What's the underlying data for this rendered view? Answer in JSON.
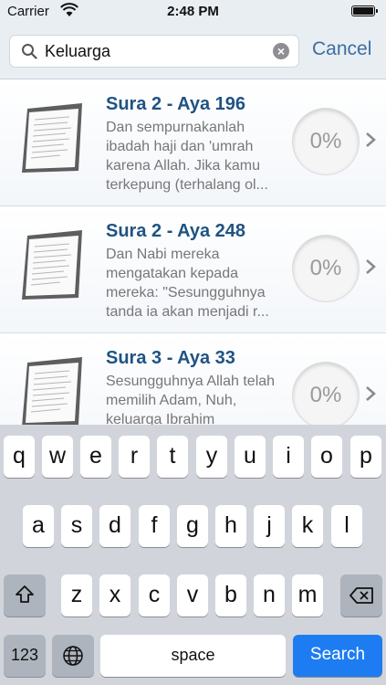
{
  "status": {
    "carrier": "Carrier",
    "time": "2:48 PM"
  },
  "search": {
    "query": "Keluarga",
    "cancel_label": "Cancel"
  },
  "results": [
    {
      "title": "Sura 2 - Aya 196",
      "text": "Dan sempurnakanlah ibadah haji dan 'umrah karena Allah. Jika kamu terkepung (terhalang ol...",
      "progress": "0%"
    },
    {
      "title": "Sura 2 - Aya 248",
      "text": "Dan Nabi mereka mengatakan kepada mereka: \"Sesungguhnya tanda ia akan menjadi r...",
      "progress": "0%"
    },
    {
      "title": "Sura 3 - Aya 33",
      "text": "Sesungguhnya Allah telah memilih Adam, Nuh, keluarga Ibrahim",
      "progress": "0%"
    }
  ],
  "keyboard": {
    "row1": [
      "q",
      "w",
      "e",
      "r",
      "t",
      "y",
      "u",
      "i",
      "o",
      "p"
    ],
    "row2": [
      "a",
      "s",
      "d",
      "f",
      "g",
      "h",
      "j",
      "k",
      "l"
    ],
    "row3": [
      "z",
      "x",
      "c",
      "v",
      "b",
      "n",
      "m"
    ],
    "numbers_label": "123",
    "space_label": "space",
    "search_label": "Search"
  },
  "icons": {
    "shift": "shift-icon",
    "delete": "backspace-icon",
    "globe": "globe-icon"
  }
}
